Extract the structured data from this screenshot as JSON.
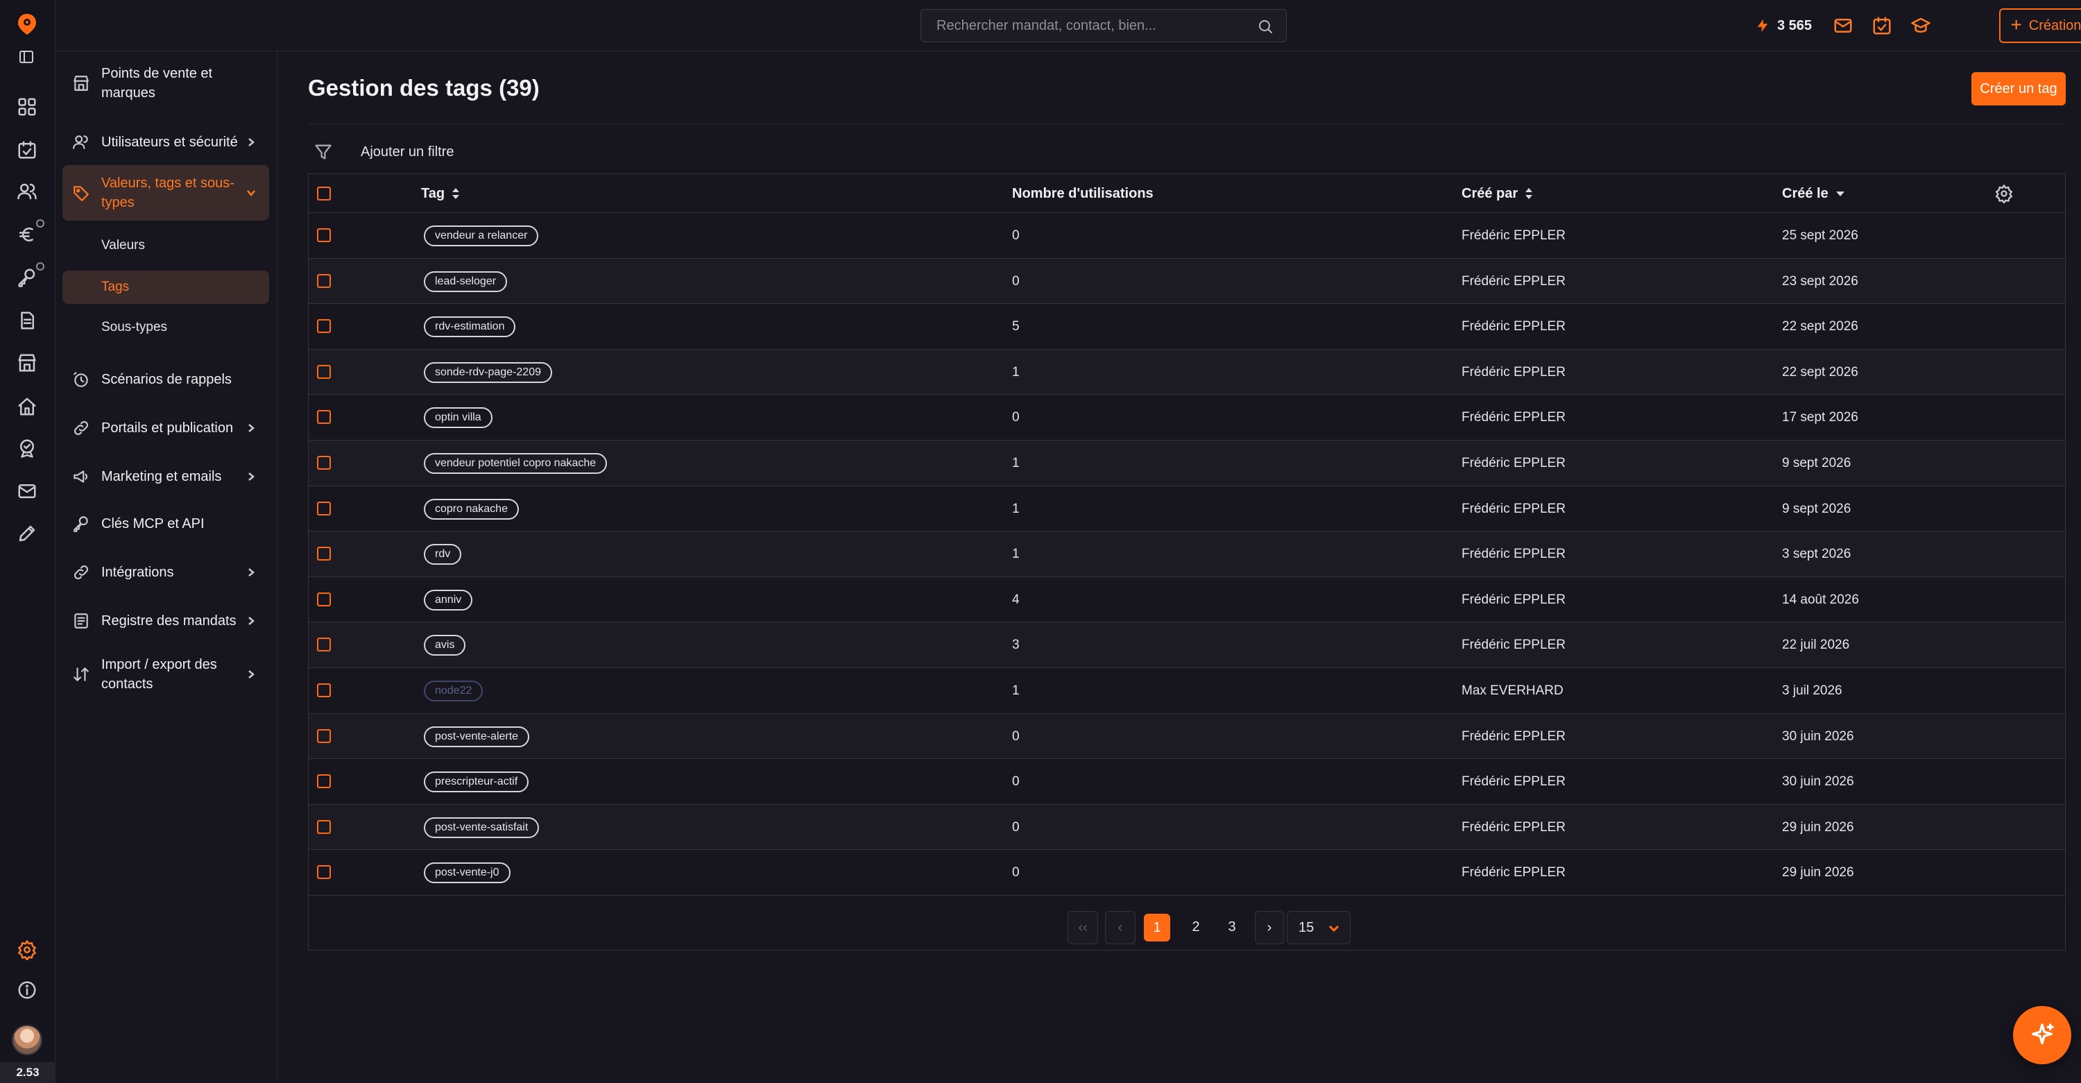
{
  "topbar": {
    "search_placeholder": "Rechercher mandat, contact, bien...",
    "credits": "3 565",
    "quick_create_label": "Création rapide"
  },
  "rail": {
    "version": "2.53",
    "icons": [
      "dashboard-icon",
      "tasks-icon",
      "contacts-icon",
      "euro-icon",
      "keys-icon",
      "documents-icon",
      "store-icon",
      "building-icon",
      "marketing-icon",
      "mail-icon",
      "pen-icon"
    ]
  },
  "sidebar": {
    "items": [
      {
        "label": "Points de vente et marques"
      },
      {
        "label": "Utilisateurs et sécurité"
      },
      {
        "label": "Valeurs, tags et sous-types"
      },
      {
        "label": "Scénarios de rappels"
      },
      {
        "label": "Portails et publication"
      },
      {
        "label": "Marketing et emails"
      },
      {
        "label": "Clés MCP et API"
      },
      {
        "label": "Intégrations"
      },
      {
        "label": "Registre des mandats"
      },
      {
        "label": "Import / export des contacts"
      }
    ],
    "sub_items": [
      {
        "label": "Valeurs"
      },
      {
        "label": "Tags"
      },
      {
        "label": "Sous-types"
      }
    ]
  },
  "main": {
    "title": "Gestion des tags (39)",
    "create_button": "Créer un tag",
    "filter_label": "Ajouter un filtre",
    "columns": {
      "tag": "Tag",
      "uses": "Nombre d'utilisations",
      "created_by": "Créé par",
      "created_on": "Créé le"
    },
    "rows": [
      {
        "tag": "vendeur a relancer",
        "uses": "0",
        "by": "Frédéric EPPLER",
        "date": "25 sept 2026"
      },
      {
        "tag": "lead-seloger",
        "uses": "0",
        "by": "Frédéric EPPLER",
        "date": "23 sept 2026"
      },
      {
        "tag": "rdv-estimation",
        "uses": "5",
        "by": "Frédéric EPPLER",
        "date": "22 sept 2026"
      },
      {
        "tag": "sonde-rdv-page-2209",
        "uses": "1",
        "by": "Frédéric EPPLER",
        "date": "22 sept 2026"
      },
      {
        "tag": "optin villa",
        "uses": "0",
        "by": "Frédéric EPPLER",
        "date": "17 sept 2026"
      },
      {
        "tag": "vendeur potentiel copro nakache",
        "uses": "1",
        "by": "Frédéric EPPLER",
        "date": "9 sept 2026"
      },
      {
        "tag": "copro nakache",
        "uses": "1",
        "by": "Frédéric EPPLER",
        "date": "9 sept 2026"
      },
      {
        "tag": "rdv",
        "uses": "1",
        "by": "Frédéric EPPLER",
        "date": "3 sept 2026"
      },
      {
        "tag": "anniv",
        "uses": "4",
        "by": "Frédéric EPPLER",
        "date": "14 août 2026"
      },
      {
        "tag": "avis",
        "uses": "3",
        "by": "Frédéric EPPLER",
        "date": "22 juil 2026"
      },
      {
        "tag": "node22",
        "uses": "1",
        "by": "Max EVERHARD",
        "date": "3 juil 2026",
        "muted": true
      },
      {
        "tag": "post-vente-alerte",
        "uses": "0",
        "by": "Frédéric EPPLER",
        "date": "30 juin 2026"
      },
      {
        "tag": "prescripteur-actif",
        "uses": "0",
        "by": "Frédéric EPPLER",
        "date": "30 juin 2026"
      },
      {
        "tag": "post-vente-satisfait",
        "uses": "0",
        "by": "Frédéric EPPLER",
        "date": "29 juin 2026"
      },
      {
        "tag": "post-vente-j0",
        "uses": "0",
        "by": "Frédéric EPPLER",
        "date": "29 juin 2026"
      }
    ],
    "pagination": {
      "first": "‹‹",
      "prev": "‹",
      "pages": [
        "1",
        "2",
        "3"
      ],
      "current": "1",
      "next": "›",
      "last": "››",
      "page_size": "15"
    }
  },
  "colors": {
    "accent": "#ff6a13",
    "background": "#17161f",
    "active_bg": "#3b2a2a"
  }
}
